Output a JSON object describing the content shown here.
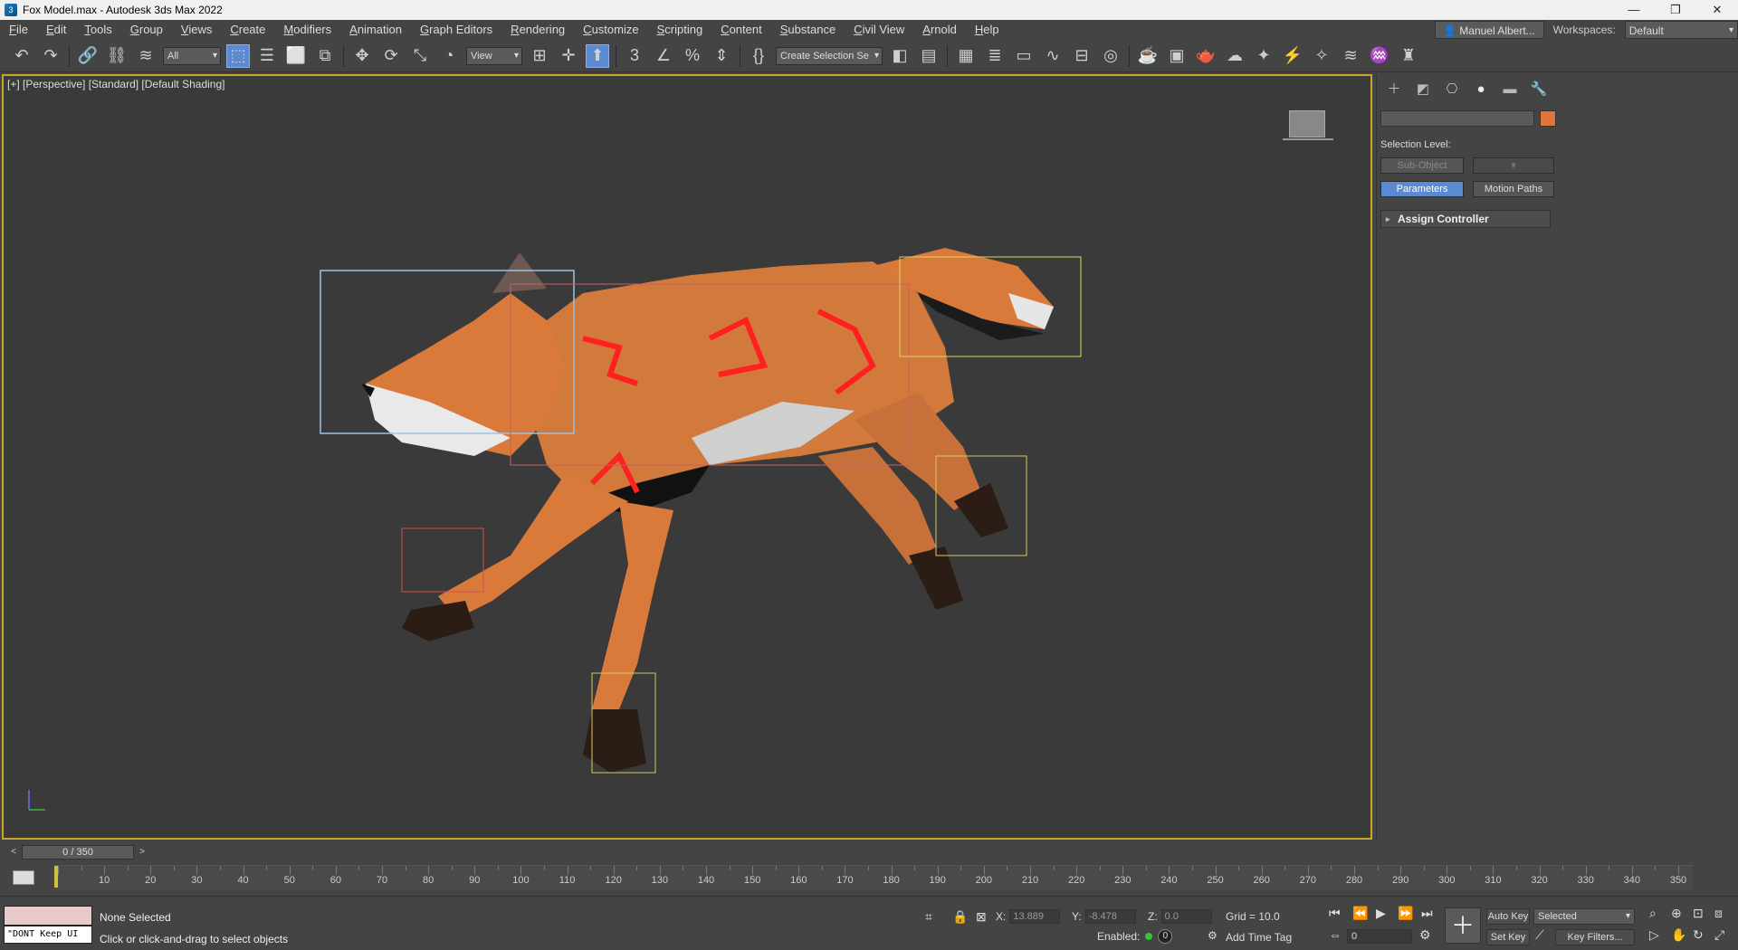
{
  "titlebar": {
    "title": "Fox Model.max - Autodesk 3ds Max 2022",
    "min": "—",
    "restore": "❐",
    "close": "✕"
  },
  "menu": [
    "File",
    "Edit",
    "Tools",
    "Group",
    "Views",
    "Create",
    "Modifiers",
    "Animation",
    "Graph Editors",
    "Rendering",
    "Customize",
    "Scripting",
    "Content",
    "Substance",
    "Civil View",
    "Arnold",
    "Help"
  ],
  "user": {
    "name": "Manuel Albert...",
    "workspaces_label": "Workspaces:",
    "workspace": "Default"
  },
  "toolbar": {
    "filter": "All",
    "coord_system": "View",
    "selection_set": "Create Selection Se"
  },
  "viewport": {
    "label": "[+] [Perspective] [Standard] [Default Shading]"
  },
  "panel": {
    "selection_level": "Selection Level:",
    "sub_object": "Sub-Object",
    "parameters": "Parameters",
    "motion_paths": "Motion Paths",
    "rollout": "Assign Controller",
    "swatch_color": "#e0753a"
  },
  "timeline": {
    "frame": "0 / 350",
    "ticks": [
      "10",
      "20",
      "30",
      "40",
      "50",
      "60",
      "70",
      "80",
      "90",
      "100",
      "110",
      "120",
      "130",
      "140",
      "150",
      "160",
      "170",
      "180",
      "190",
      "200",
      "210",
      "220",
      "230",
      "240",
      "250",
      "260",
      "270",
      "280",
      "290",
      "300",
      "310",
      "320",
      "330",
      "340",
      "350"
    ]
  },
  "status": {
    "selection": "None Selected",
    "prompt": "Click or click-and-drag to select objects",
    "script": "\"DONT Keep UI"
  },
  "coords": {
    "x_label": "X:",
    "x": "13.889",
    "y_label": "Y:",
    "y": "-8.478",
    "z_label": "Z:",
    "z": "0.0",
    "grid": "Grid = 10.0"
  },
  "anim": {
    "auto_key": "Auto Key",
    "set_key": "Set Key",
    "selected": "Selected",
    "key_filters": "Key Filters...",
    "frame": "0",
    "enabled": "Enabled:",
    "add_time_tag": "Add Time Tag",
    "zero": "0"
  }
}
